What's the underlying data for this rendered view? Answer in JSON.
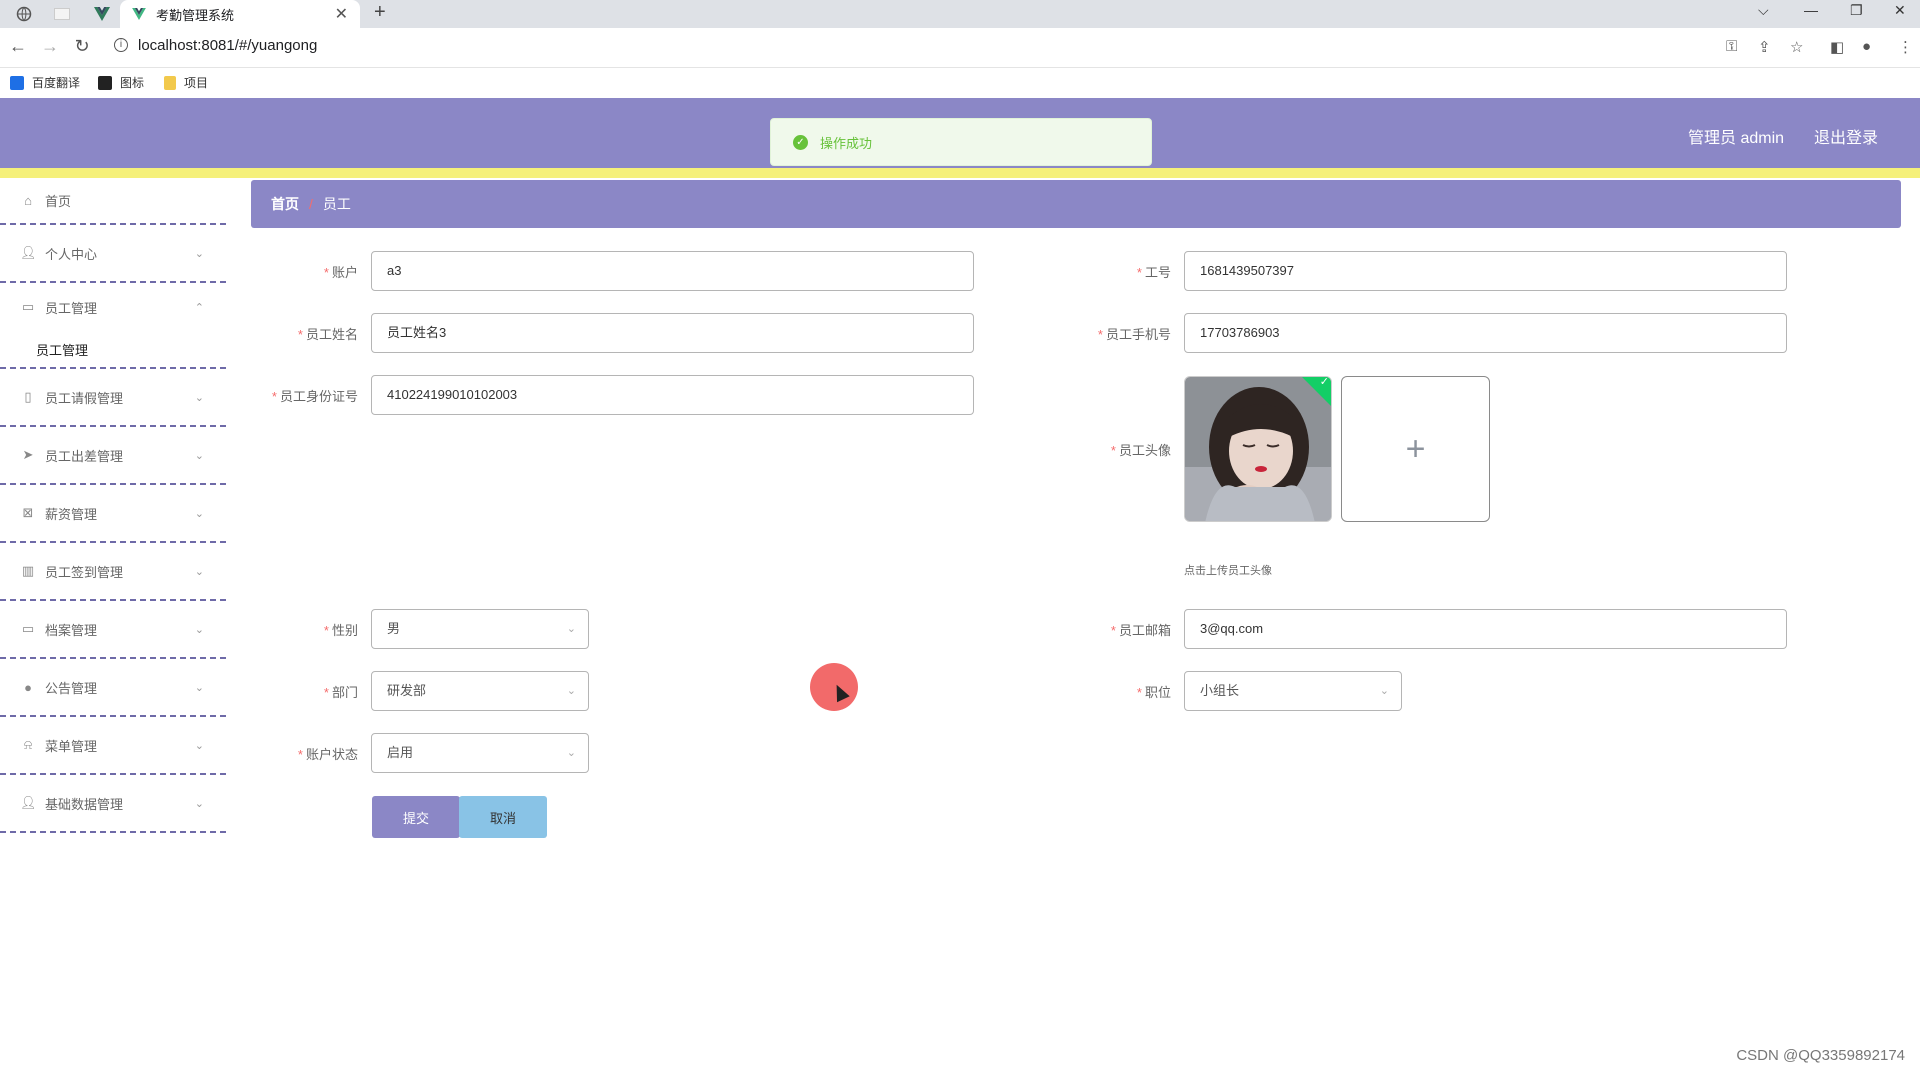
{
  "browser": {
    "tab_title": "考勤管理系统",
    "url": "localhost:8081/#/yuangong",
    "bookmarks": [
      {
        "label": "百度翻译",
        "color": "#1e6fe5"
      },
      {
        "label": "图标",
        "color": "#222222"
      },
      {
        "label": "项目",
        "color": "#f2c94c"
      }
    ]
  },
  "header": {
    "user_label": "管理员 admin",
    "logout_label": "退出登录",
    "bg_color": "#8b87c6",
    "accent_line_color": "#f5f07a"
  },
  "toast": {
    "message": "操作成功",
    "status": "success",
    "color": "#67c23a"
  },
  "sidebar": {
    "items": [
      {
        "label": "首页",
        "icon": "home-icon",
        "expandable": false
      },
      {
        "label": "个人中心",
        "icon": "user-icon",
        "expandable": true,
        "expanded": false
      },
      {
        "label": "员工管理",
        "icon": "id-card-icon",
        "expandable": true,
        "expanded": true
      },
      {
        "label": "员工请假管理",
        "icon": "medal-icon",
        "expandable": true,
        "expanded": false
      },
      {
        "label": "员工出差管理",
        "icon": "send-icon",
        "expandable": true,
        "expanded": false
      },
      {
        "label": "薪资管理",
        "icon": "money-icon",
        "expandable": true,
        "expanded": false
      },
      {
        "label": "员工签到管理",
        "icon": "chart-icon",
        "expandable": true,
        "expanded": false
      },
      {
        "label": "档案管理",
        "icon": "chat-icon",
        "expandable": true,
        "expanded": false
      },
      {
        "label": "公告管理",
        "icon": "bulb-icon",
        "expandable": true,
        "expanded": false
      },
      {
        "label": "菜单管理",
        "icon": "bell-icon",
        "expandable": true,
        "expanded": false
      },
      {
        "label": "基础数据管理",
        "icon": "user-icon",
        "expandable": true,
        "expanded": false
      }
    ],
    "subitem": "员工管理"
  },
  "breadcrumb": {
    "home": "首页",
    "separator": "/",
    "current": "员工"
  },
  "form": {
    "account": {
      "label": "账户",
      "value": "a3"
    },
    "employee_no": {
      "label": "工号",
      "value": "1681439507397"
    },
    "name": {
      "label": "员工姓名",
      "value": "员工姓名3"
    },
    "phone": {
      "label": "员工手机号",
      "value": "17703786903"
    },
    "id_card": {
      "label": "员工身份证号",
      "value": "410224199010102003"
    },
    "avatar": {
      "label": "员工头像",
      "hint": "点击上传员工头像",
      "upload_icon": "plus-icon"
    },
    "gender": {
      "label": "性别",
      "value": "男"
    },
    "email": {
      "label": "员工邮箱",
      "value": "3@qq.com"
    },
    "department": {
      "label": "部门",
      "value": "研发部"
    },
    "position": {
      "label": "职位",
      "value": "小组长"
    },
    "status": {
      "label": "账户状态",
      "value": "启用"
    }
  },
  "actions": {
    "submit": "提交",
    "cancel": "取消"
  },
  "watermark": "CSDN @QQ3359892174"
}
